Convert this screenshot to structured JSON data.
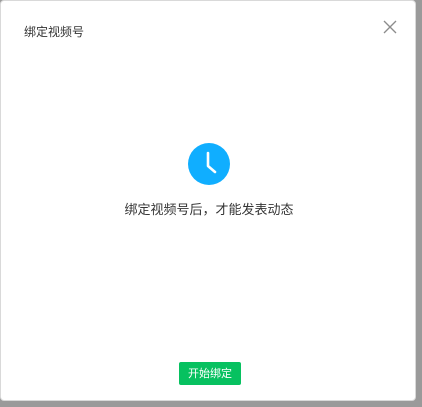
{
  "dialog": {
    "title": "绑定视频号",
    "close_icon": "close-icon",
    "status_icon": "clock-icon",
    "message": "绑定视频号后，才能发表动态",
    "start_button_label": "开始绑定"
  },
  "colors": {
    "accent_blue": "#10aeff",
    "button_green": "#07c160",
    "backdrop": "#9a9a9a"
  }
}
